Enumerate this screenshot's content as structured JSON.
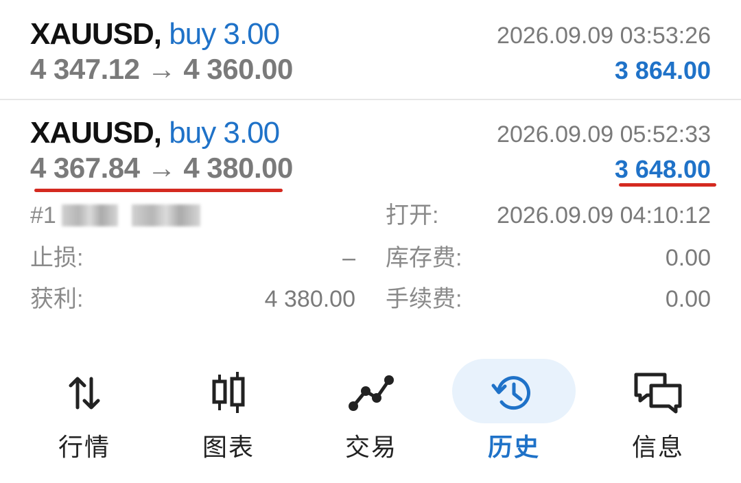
{
  "trades": [
    {
      "symbol": "XAUUSD,",
      "side": "buy 3.00",
      "price_open": "4 347.12",
      "arrow": "→",
      "price_close": "4 360.00",
      "time": "2026.09.09 03:53:26",
      "profit": "3 864.00"
    },
    {
      "symbol": "XAUUSD,",
      "side": "buy 3.00",
      "price_open": "4 367.84",
      "arrow": "→",
      "price_close": "4 380.00",
      "time": "2026.09.09 05:52:33",
      "profit": "3 648.00"
    }
  ],
  "details": {
    "order_prefix": "#1",
    "open_label": "打开:",
    "open_time": "2026.09.09 04:10:12",
    "sl_label": "止损:",
    "sl_value": "–",
    "swap_label": "库存费:",
    "swap_value": "0.00",
    "tp_label": "获利:",
    "tp_value": "4 380.00",
    "commission_label": "手续费:",
    "commission_value": "0.00"
  },
  "nav": {
    "items": [
      {
        "label": "行情",
        "icon": "arrows-up-down-icon"
      },
      {
        "label": "图表",
        "icon": "candlestick-icon"
      },
      {
        "label": "交易",
        "icon": "trade-line-icon"
      },
      {
        "label": "历史",
        "icon": "history-clock-icon",
        "active": true
      },
      {
        "label": "信息",
        "icon": "chat-bubbles-icon"
      }
    ]
  },
  "colors": {
    "accent": "#1f72c8",
    "highlight": "#d42a20",
    "muted": "#7a7a7a",
    "active_bg": "#e8f2fc"
  }
}
